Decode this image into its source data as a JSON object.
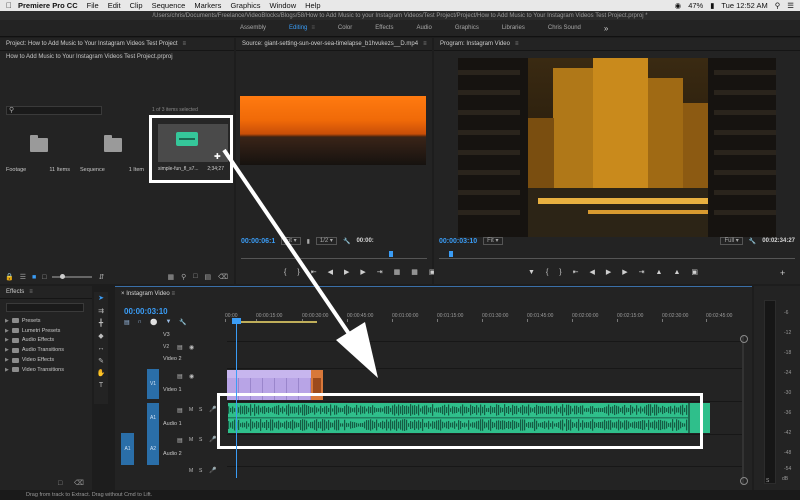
{
  "menubar": {
    "app": "Premiere Pro CC",
    "items": [
      "File",
      "Edit",
      "Clip",
      "Sequence",
      "Markers",
      "Graphics",
      "Window",
      "Help"
    ],
    "battery": "47%",
    "clock": "Tue 12:52 AM"
  },
  "titlebar": {
    "path": "/Users/chris/Documents/Freelance/VideoBlocks/Blogs/58/How to Add Music to your Instagram Videos/Test Project/Project/How to Add Music to Your Instagram Videos Test Project.prproj *"
  },
  "workspaces": [
    "Assembly",
    "Editing",
    "Color",
    "Effects",
    "Audio",
    "Graphics",
    "Libraries",
    "Chris Sound"
  ],
  "active_workspace": "Editing",
  "project": {
    "header": "Project: How to Add Music to Your Instagram Videos Test Project",
    "file": "How to Add Music to Your Instagram Videos Test Project.prproj",
    "count": "1 of 3 items selected",
    "bins": [
      {
        "name": "Footage",
        "count": "11 Items"
      },
      {
        "name": "Sequence",
        "count": "1 Item"
      }
    ],
    "audio_item": {
      "name": "simple-fun_fl_s7...",
      "duration": "2;34;27"
    }
  },
  "source": {
    "header": "Source: giant-setting-sun-over-sea-timelapse_b1hvukezs__D.mp4",
    "timecode": "00:00:06:1",
    "fit": "Fit",
    "resolution": "1/2",
    "duration": "00:00:"
  },
  "program": {
    "header": "Program: Instagram Video",
    "timecode": "00:00:03:10",
    "fit": "Fit",
    "resolution": "Full",
    "duration": "00:02:34:27"
  },
  "effects": {
    "header": "Effects",
    "items": [
      "Presets",
      "Lumetri Presets",
      "Audio Effects",
      "Audio Transitions",
      "Video Effects",
      "Video Transitions"
    ]
  },
  "timeline": {
    "tab": "Instagram Video",
    "timecode": "00:00:03:10",
    "ruler": [
      "00:00",
      "00:00:15:00",
      "00:00:30:00",
      "00:00:45:00",
      "00:01:00:00",
      "00:01:15:00",
      "00:01:30:00",
      "00:01:45:00",
      "00:02:00:00",
      "00:02:15:00",
      "00:02:30:00",
      "00:02:45:00"
    ],
    "tracks": {
      "v3": "V3",
      "v2": "V2",
      "v2_name": "Video 2",
      "v1": "V1",
      "v1_name": "Video 1",
      "a1": "A1",
      "a1_name": "Audio 1",
      "a2": "A2",
      "a2_name": "Audio 2",
      "src_a1": "A1",
      "mute": "M",
      "solo": "S"
    }
  },
  "meters": {
    "labels": [
      "-6",
      "-12",
      "-18",
      "-24",
      "-30",
      "-36",
      "-42",
      "-48",
      "-54"
    ],
    "bottom": "dB",
    "solo": "S"
  },
  "status": "Drag from track to Extract. Drag without Cmd to Lift."
}
